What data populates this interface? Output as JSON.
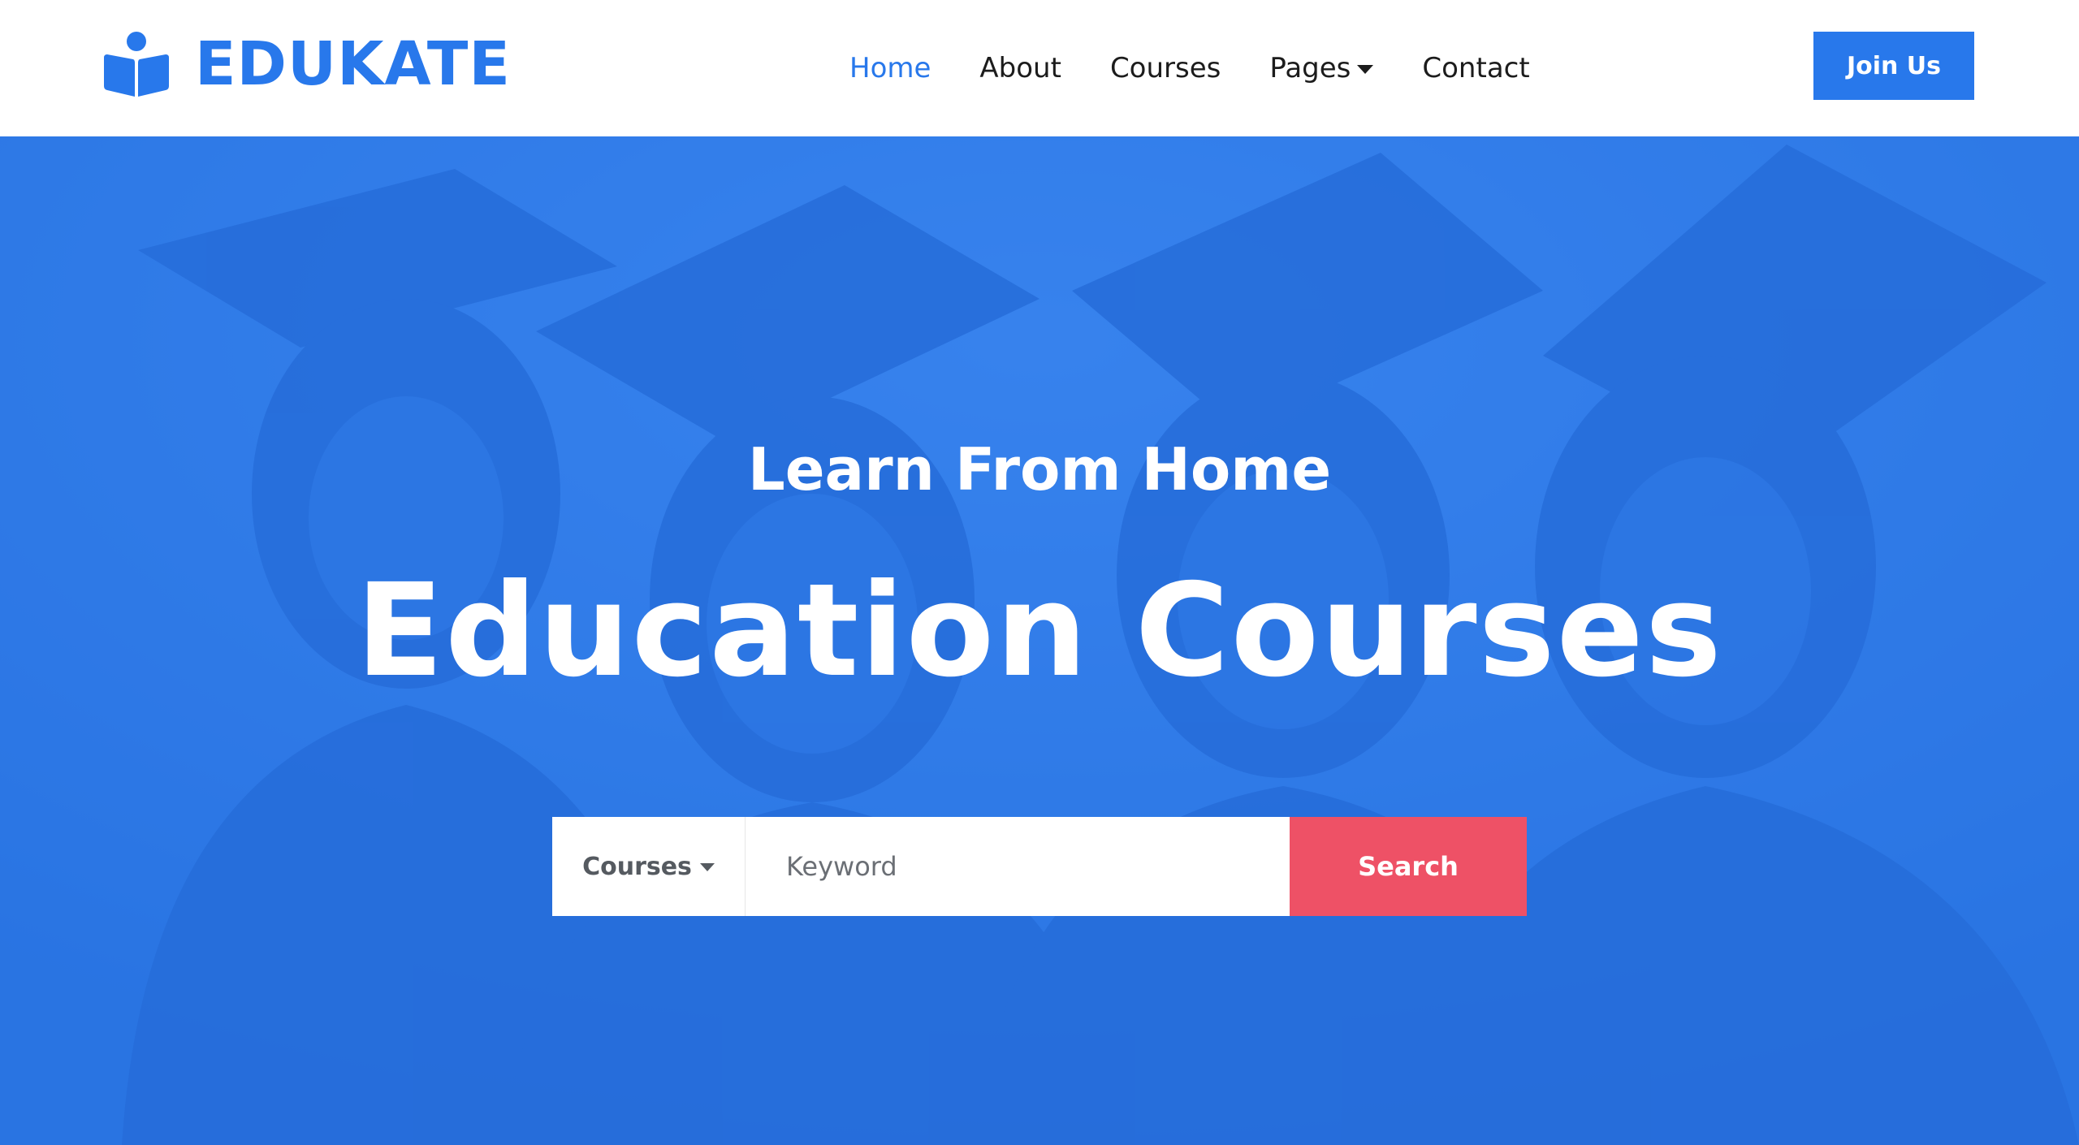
{
  "brand": {
    "name": "EDUKATE",
    "icon": "book-reader-icon"
  },
  "nav": {
    "items": [
      {
        "label": "Home",
        "active": true
      },
      {
        "label": "About"
      },
      {
        "label": "Courses"
      },
      {
        "label": "Pages",
        "dropdown": true
      },
      {
        "label": "Contact"
      }
    ],
    "join_label": "Join Us"
  },
  "hero": {
    "subtitle": "Learn From Home",
    "title": "Education Courses"
  },
  "search": {
    "category_selected": "Courses",
    "placeholder": "Keyword",
    "value": "",
    "button_label": "Search"
  },
  "colors": {
    "primary": "#2878EB",
    "accent": "#EE5166",
    "overlay": "#2878EB",
    "text_dark": "#1c1c1c"
  }
}
